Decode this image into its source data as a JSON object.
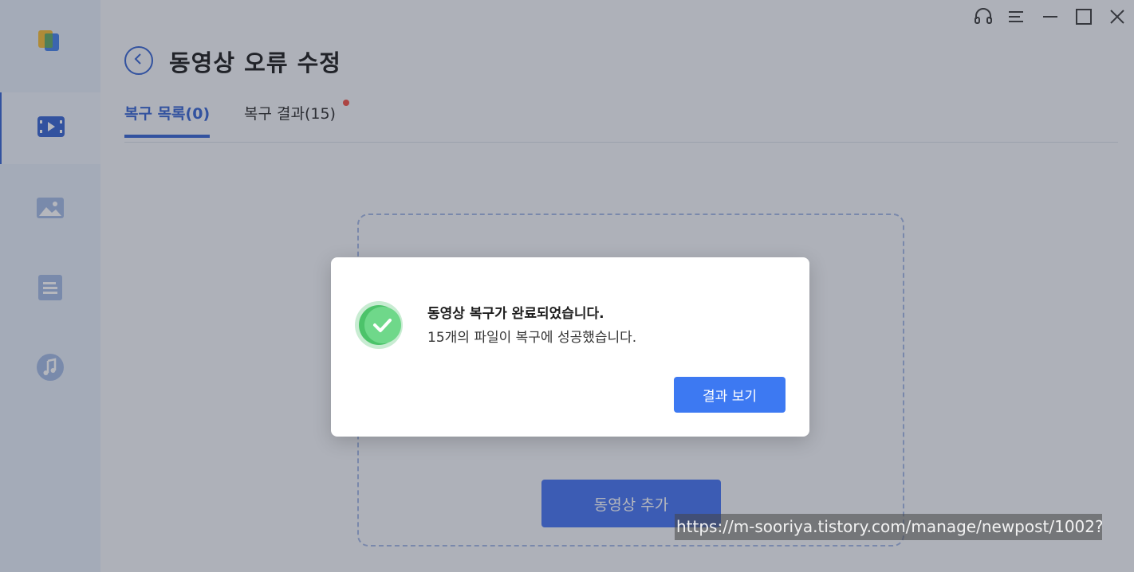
{
  "app": {
    "page_title": "동영상 오류 수정"
  },
  "sidebar": {
    "items": [
      {
        "name": "video",
        "icon": "video-icon",
        "active": true
      },
      {
        "name": "photo",
        "icon": "image-icon",
        "active": false
      },
      {
        "name": "document",
        "icon": "document-icon",
        "active": false
      },
      {
        "name": "audio",
        "icon": "music-icon",
        "active": false
      }
    ]
  },
  "titlebar": {
    "icons": [
      "headset-icon",
      "menu-icon",
      "minimize-icon",
      "maximize-icon",
      "close-icon"
    ]
  },
  "tabs": [
    {
      "label": "복구 목록(0)",
      "active": true
    },
    {
      "label": "복구 결과(15)",
      "active": false,
      "notification_dot": true
    }
  ],
  "main": {
    "add_button_label": "동영상 추가"
  },
  "dialog": {
    "title": "동영상 복구가 완료되었습니다.",
    "message": "15개의 파일이 복구에 성공했습니다.",
    "button_label": "결과 보기"
  },
  "status_url": "https://m-sooriya.tistory.com/manage/newpost/1002?",
  "colors": {
    "accent": "#2d5ccf",
    "button": "#3d79f2",
    "success": "#4cc36a",
    "notification_dot": "#f0473a"
  }
}
